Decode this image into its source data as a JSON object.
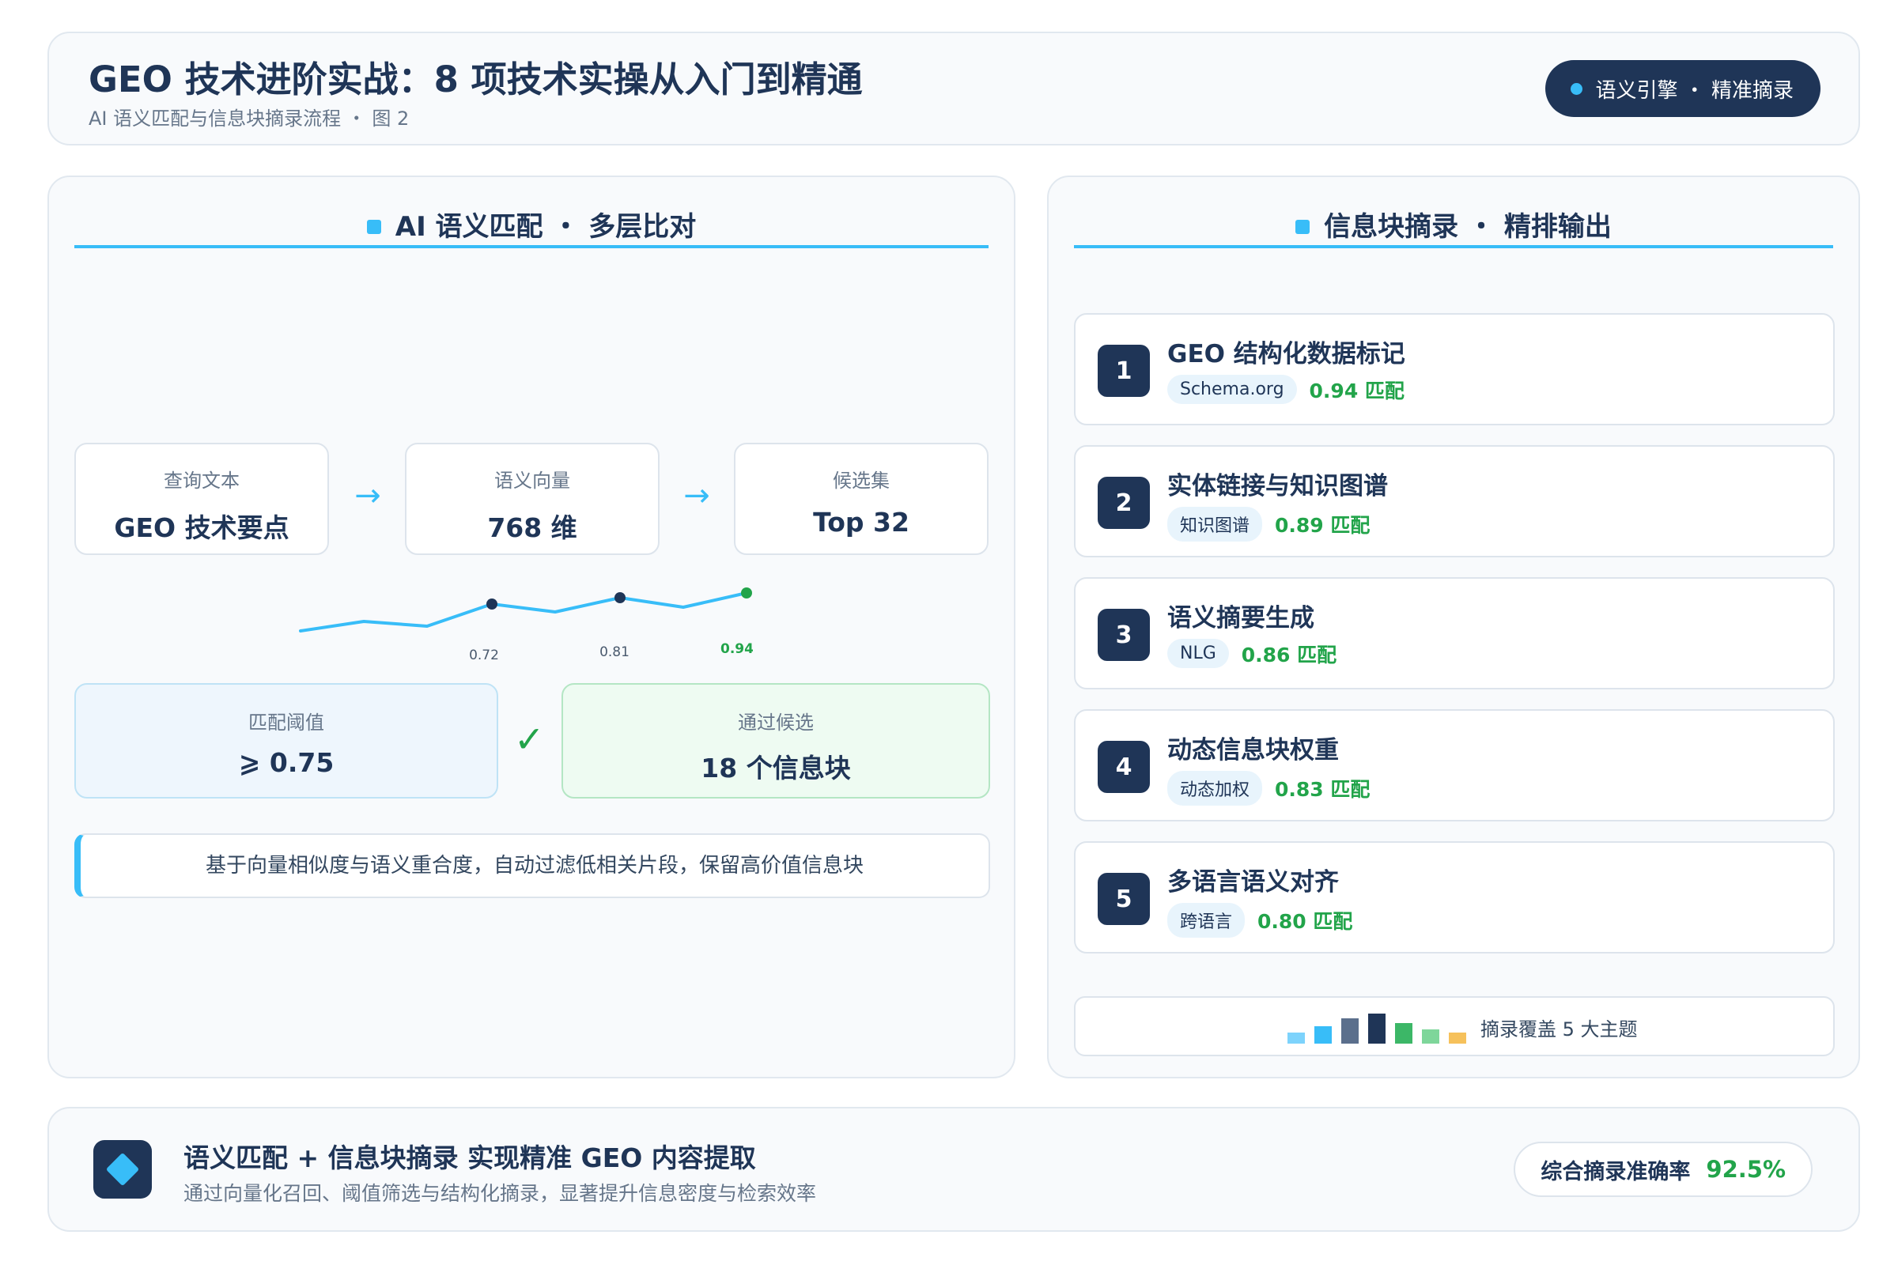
{
  "header": {
    "title": "GEO 技术进阶实战：8 项技术实操从入门到精通",
    "subtitle": "AI 语义匹配与信息块摘录流程 ・ 图 2",
    "tag": "语义引擎 ・ 精准摘录"
  },
  "left_panel": {
    "title": "AI 语义匹配 ・ 多层比对",
    "flow": [
      {
        "label": "查询文本",
        "value": "GEO 技术要点"
      },
      {
        "label": "语义向量",
        "value": "768 维"
      },
      {
        "label": "候选集",
        "value": "Top 32"
      }
    ],
    "flow_arrow": "→",
    "sparkline_labels": [
      "0.72",
      "0.81",
      "0.94"
    ],
    "threshold": {
      "label": "匹配阈值",
      "value": "⩾ 0.75"
    },
    "check_icon": "✓",
    "pass": {
      "label": "通过候选",
      "value": "18 个信息块"
    },
    "note": "基于向量相似度与语义重合度，自动过滤低相关片段，保留高价值信息块"
  },
  "right_panel": {
    "title": "信息块摘录 ・ 精排输出",
    "items": [
      {
        "num": "1",
        "name": "GEO 结构化数据标记",
        "tag": "Schema.org",
        "score": "0.94 匹配"
      },
      {
        "num": "2",
        "name": "实体链接与知识图谱",
        "tag": "知识图谱",
        "score": "0.89 匹配"
      },
      {
        "num": "3",
        "name": "语义摘要生成",
        "tag": "NLG",
        "score": "0.86 匹配"
      },
      {
        "num": "4",
        "name": "动态信息块权重",
        "tag": "动态加权",
        "score": "0.83 匹配"
      },
      {
        "num": "5",
        "name": "多语言语义对齐",
        "tag": "跨语言",
        "score": "0.80 匹配"
      }
    ],
    "coverage_text": "摘录覆盖 5 大主题"
  },
  "footer": {
    "title": "语义匹配 + 信息块摘录 实现精准 GEO 内容提取",
    "description": "通过向量化召回、阈值筛选与结构化摘录，显著提升信息密度与检索效率",
    "accuracy_label": "综合摘录准确率",
    "accuracy_value": "92.5%"
  },
  "colors": {
    "navy": "#1f3557",
    "accent_blue": "#38bdf8",
    "success_green": "#22a44a"
  }
}
